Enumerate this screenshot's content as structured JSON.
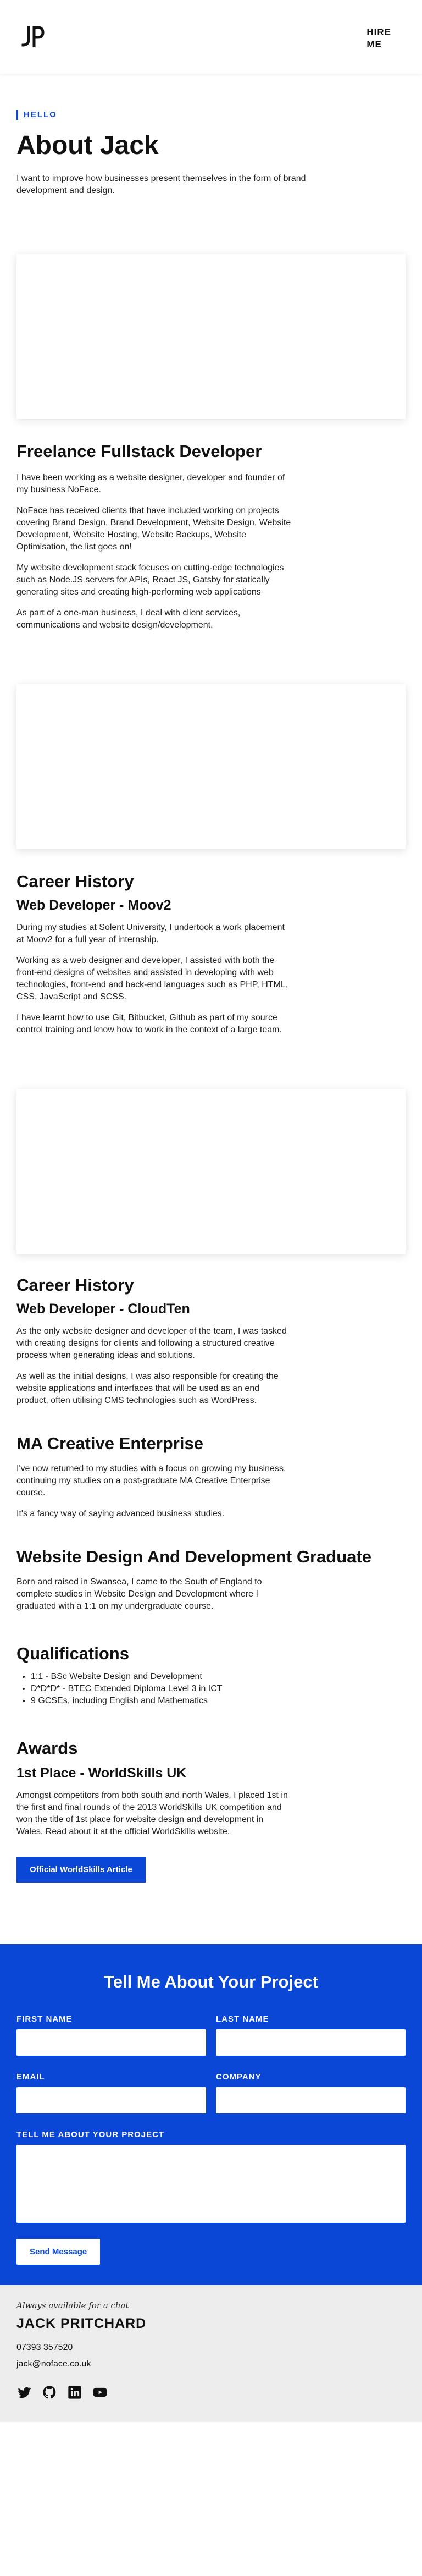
{
  "header": {
    "hire_label_line1": "HIRE",
    "hire_label_line2": "ME"
  },
  "hero": {
    "eyebrow": "HELLO",
    "title": "About Jack",
    "intro": "I want to improve how businesses present themselves in the form of brand development and design."
  },
  "freelance": {
    "title": "Freelance Fullstack Developer",
    "p1": "I have been working as a website designer, developer and founder of my business NoFace.",
    "p2": "NoFace has received clients that have included working on projects covering Brand Design, Brand Development, Website Design, Website Development, Website Hosting, Website Backups, Website Optimisation, the list goes on!",
    "p3": "My website development stack focuses on cutting-edge technologies such as Node.JS servers for APIs, React JS, Gatsby for statically generating sites and creating high-performing web applications",
    "p4": "As part of a one-man business, I deal with client services, communications and website design/development."
  },
  "career1": {
    "title": "Career History",
    "role": "Web Developer - Moov2",
    "p1": "During my studies at Solent University, I undertook a work placement at Moov2 for a full year of internship.",
    "p2": "Working as a web designer and developer, I assisted with both the front-end designs of websites and assisted in developing with web technologies, front-end and back-end languages such as PHP, HTML, CSS, JavaScript and SCSS.",
    "p3": "I have learnt how to use Git, Bitbucket, Github as part of my source control training and know how to work in the context of a large team."
  },
  "career2": {
    "title": "Career History",
    "role": "Web Developer - CloudTen",
    "p1": "As the only website designer and developer of the team, I was tasked with creating designs for clients and following a structured creative process when generating ideas and solutions.",
    "p2": "As well as the initial designs, I was also responsible for creating the website applications and interfaces that will be used as an end product, often utilising CMS technologies such as WordPress."
  },
  "ma": {
    "title": "MA Creative Enterprise",
    "p1": "I've now returned to my studies with a focus on growing my business, continuing my studies on a post-graduate MA Creative Enterprise course.",
    "p2": "It's a fancy way of saying advanced business studies."
  },
  "graduate": {
    "title": "Website Design And Development Graduate",
    "p1": "Born and raised in Swansea, I came to the South of England to complete studies in Website Design and Development where I graduated with a 1:1 on my undergraduate course."
  },
  "qualifications": {
    "title": "Qualifications",
    "items": [
      "1:1 - BSc Website Design and Development",
      "D*D*D* - BTEC Extended Diploma Level 3 in ICT",
      "9 GCSEs, including English and Mathematics"
    ]
  },
  "awards": {
    "title": "Awards",
    "award": "1st Place - WorldSkills UK",
    "p1": "Amongst competitors from both south and north Wales, I placed 1st in the first and final rounds of the 2013 WorldSkills UK competition and won the title of 1st place for website design and development in Wales. Read about it at the official WorldSkills website.",
    "button": "Official WorldSkills Article"
  },
  "contact": {
    "title": "Tell Me About Your Project",
    "first_name": "FIRST NAME",
    "last_name": "LAST NAME",
    "email": "EMAIL",
    "company": "COMPANY",
    "message": "TELL ME ABOUT YOUR PROJECT",
    "send": "Send Message"
  },
  "footer": {
    "availability": "Always available for a chat",
    "name": "JACK PRITCHARD",
    "phone": "07393 357520",
    "email": "jack@noface.co.uk",
    "social": [
      "twitter-icon",
      "github-icon",
      "linkedin-icon",
      "youtube-icon"
    ]
  },
  "colors": {
    "accent": "#0a47d6",
    "footer_bg": "#ededed"
  }
}
